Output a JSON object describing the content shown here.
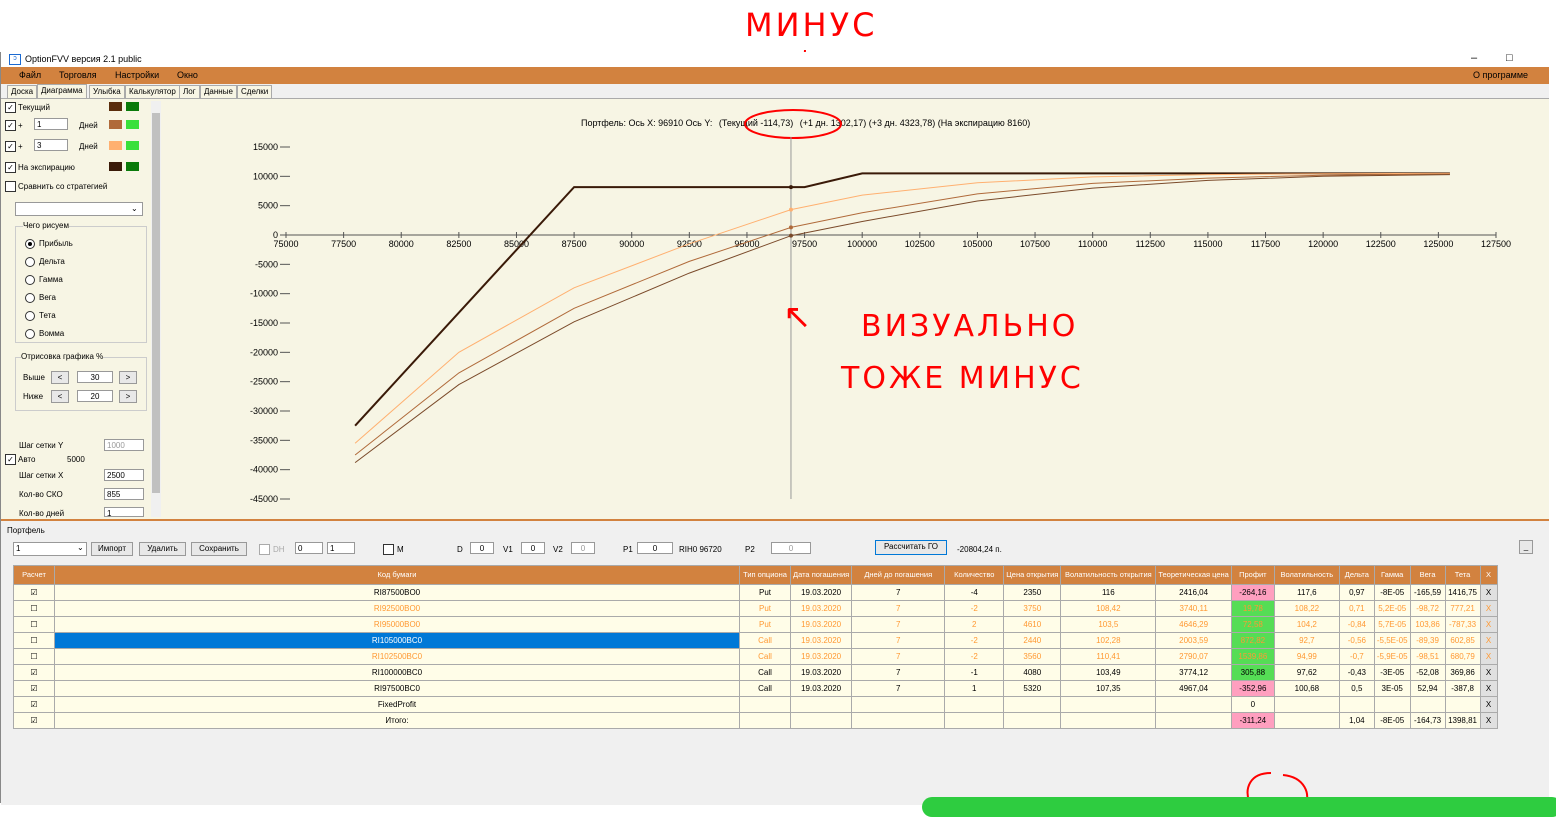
{
  "annotations": {
    "top": "МИНУС",
    "middle_line1": "ВИЗУАЛЬНО",
    "middle_line2": "ТОЖЕ МИНУС",
    "arrow_glyph": "↖"
  },
  "window": {
    "title": "OptionFVV версия 2.1 public",
    "min": "–",
    "max": "□"
  },
  "menu": {
    "items": [
      "Файл",
      "Торговля",
      "Настройки",
      "Окно"
    ],
    "about": "О программе"
  },
  "tabs": [
    "Доска",
    "Диаграмма",
    "Улыбка",
    "Калькулятор",
    "Лог",
    "Данные",
    "Сделки"
  ],
  "left": {
    "current": "Текущий",
    "plus": "+",
    "days1": "1",
    "days_label": "Дней",
    "days2": "3",
    "expiration": "На экспирацию",
    "compare": "Сравнить со стратегией",
    "what_draw": "Чего рисуем",
    "radios": [
      "Прибыль",
      "Дельта",
      "Гамма",
      "Вега",
      "Тета",
      "Вомма"
    ],
    "draw_pct": "Отрисовка графика %",
    "above": "Выше",
    "above_val": "30",
    "below": "Ниже",
    "below_val": "20",
    "lt": "<",
    "gt": ">",
    "grid_y": "Шаг сетки Y",
    "grid_y_val": "1000",
    "auto": "Авто",
    "auto_val": "5000",
    "grid_x": "Шаг сетки X",
    "grid_x_val": "2500",
    "sko": "Кол-во СКО",
    "sko_val": "855",
    "days_count": "Кол-во дней",
    "days_count_val": "1"
  },
  "colors": {
    "current_dark": "#5a2d0c",
    "current_green": "#0a7a0a",
    "plus1_brown": "#b06a3a",
    "plus1_green": "#3ae03a",
    "plus3_orange": "#ffb070",
    "plus3_green": "#3ae03a",
    "exp_dark": "#3a1a08",
    "exp_green": "#0a7a0a",
    "menu": "#d2823f"
  },
  "chart_header": {
    "prefix": "Портфель: Ось X: 96910 Ось Y:",
    "current": "(Текущий -114,73)",
    "rest": "(+1 дн. 1302,17)  (+3 дн. 4323,78)  (На экспирацию 8160)"
  },
  "chart_data": {
    "type": "line",
    "x_ticks": [
      "75000",
      "77500",
      "80000",
      "82500",
      "85000",
      "87500",
      "90000",
      "92500",
      "95000",
      "97500",
      "100000",
      "102500",
      "105000",
      "107500",
      "110000",
      "112500",
      "115000",
      "117500",
      "120000",
      "122500",
      "125000",
      "127500"
    ],
    "y_ticks": [
      "15000",
      "10000",
      "5000",
      "0",
      "-5000",
      "-10000",
      "-15000",
      "-20000",
      "-25000",
      "-30000",
      "-35000",
      "-40000",
      "-45000"
    ],
    "xlim": [
      75000,
      127500
    ],
    "ylim": [
      -45000,
      15000
    ],
    "cursor_x": 96910,
    "series": [
      {
        "color": "#3a1a08",
        "x": [
          78000,
          87500,
          96910,
          97500,
          100000,
          125500
        ],
        "y": [
          -32500,
          8160,
          8160,
          8160,
          10500,
          10500
        ]
      },
      {
        "color": "#ffb070",
        "x": [
          78000,
          82500,
          87500,
          92500,
          96910,
          100000,
          105000,
          110000,
          115000,
          120000,
          125500
        ],
        "y": [
          -35500,
          -20000,
          -9000,
          -1500,
          4324,
          6800,
          8900,
          9900,
          10300,
          10450,
          10500
        ]
      },
      {
        "color": "#b06a3a",
        "x": [
          78000,
          82500,
          87500,
          92500,
          96910,
          100000,
          105000,
          110000,
          115000,
          120000,
          125500
        ],
        "y": [
          -37500,
          -23500,
          -12500,
          -4500,
          1302,
          3800,
          7000,
          8800,
          9700,
          10200,
          10400
        ]
      },
      {
        "color": "#7a4a2a",
        "x": [
          78000,
          82500,
          87500,
          92500,
          96910,
          100000,
          105000,
          110000,
          115000,
          120000,
          125500
        ],
        "y": [
          -38800,
          -25500,
          -14800,
          -6500,
          -115,
          2300,
          5800,
          8000,
          9300,
          10000,
          10300
        ]
      }
    ]
  },
  "portfolio": {
    "title": "Портфель",
    "select": "1",
    "import": "Импорт",
    "delete": "Удалить",
    "save": "Сохранить",
    "dh": "DH",
    "dh_v1": "0",
    "dh_v2": "1",
    "m": "M",
    "d": "D",
    "d_val": "0",
    "v1": "V1",
    "v1_val": "0",
    "v2": "V2",
    "v2_val": "0",
    "p1": "P1",
    "p1_val": "0",
    "rih": "RIH0 96720",
    "p2": "P2",
    "p2_val": "0",
    "calc_go": "Рассчитать ГО",
    "go_val": "-20804,24 п.",
    "collapse": "_"
  },
  "table": {
    "headers": [
      "Расчет",
      "Код бумаги",
      "Тип опциона",
      "Дата погашения",
      "Дней до погашения",
      "Количество",
      "Цена открытия",
      "Волатильность открытия",
      "Теоретическая цена",
      "Профит",
      "Волатильность",
      "Дельта",
      "Гамма",
      "Вега",
      "Тета",
      "X"
    ],
    "rows": [
      {
        "check": "☑",
        "code": "RI87500BO0",
        "type": "Put",
        "date": "19.03.2020",
        "days": "7",
        "qty": "-4",
        "price": "2350",
        "vol_open": "116",
        "theo": "2416,04",
        "profit": "-264,16",
        "vol": "117,6",
        "delta": "0,97",
        "gamma": "-8E-05",
        "vega": "-165,59",
        "theta": "1416,75",
        "x": "X"
      },
      {
        "check": "☐",
        "code": "RI92500BO0",
        "type": "Put",
        "date": "19.03.2020",
        "days": "7",
        "qty": "-2",
        "price": "3750",
        "vol_open": "108,42",
        "theo": "3740,11",
        "profit": "19,78",
        "vol": "108,22",
        "delta": "0,71",
        "gamma": "5,2E-05",
        "vega": "-98,72",
        "theta": "777,21",
        "x": "X"
      },
      {
        "check": "☐",
        "code": "RI95000BO0",
        "type": "Put",
        "date": "19.03.2020",
        "days": "7",
        "qty": "2",
        "price": "4610",
        "vol_open": "103,5",
        "theo": "4646,29",
        "profit": "72,58",
        "vol": "104,2",
        "delta": "-0,84",
        "gamma": "5,7E-05",
        "vega": "103,86",
        "theta": "-787,33",
        "x": "X"
      },
      {
        "check": "☐",
        "code": "RI105000BC0",
        "type": "Call",
        "date": "19.03.2020",
        "days": "7",
        "qty": "-2",
        "price": "2440",
        "vol_open": "102,28",
        "theo": "2003,59",
        "profit": "872,82",
        "vol": "92,7",
        "delta": "-0,56",
        "gamma": "-5,5E-05",
        "vega": "-89,39",
        "theta": "602,85",
        "x": "X"
      },
      {
        "check": "☐",
        "code": "RI102500BC0",
        "type": "Call",
        "date": "19.03.2020",
        "days": "7",
        "qty": "-2",
        "price": "3560",
        "vol_open": "110,41",
        "theo": "2790,07",
        "profit": "1539,86",
        "vol": "94,99",
        "delta": "-0,7",
        "gamma": "-5,9E-05",
        "vega": "-98,51",
        "theta": "680,79",
        "x": "X"
      },
      {
        "check": "☑",
        "code": "RI100000BC0",
        "type": "Call",
        "date": "19.03.2020",
        "days": "7",
        "qty": "-1",
        "price": "4080",
        "vol_open": "103,49",
        "theo": "3774,12",
        "profit": "305,88",
        "vol": "97,62",
        "delta": "-0,43",
        "gamma": "-3E-05",
        "vega": "-52,08",
        "theta": "369,86",
        "x": "X"
      },
      {
        "check": "☑",
        "code": "RI97500BC0",
        "type": "Call",
        "date": "19.03.2020",
        "days": "7",
        "qty": "1",
        "price": "5320",
        "vol_open": "107,35",
        "theo": "4967,04",
        "profit": "-352,96",
        "vol": "100,68",
        "delta": "0,5",
        "gamma": "3E-05",
        "vega": "52,94",
        "theta": "-387,8",
        "x": "X"
      },
      {
        "check": "☑",
        "code": "FixedProfit",
        "type": "",
        "date": "",
        "days": "",
        "qty": "",
        "price": "",
        "vol_open": "",
        "theo": "",
        "profit": "0",
        "vol": "",
        "delta": "",
        "gamma": "",
        "vega": "",
        "theta": "",
        "x": "X"
      },
      {
        "check": "☑",
        "code": "Итого:",
        "type": "",
        "date": "",
        "days": "",
        "qty": "",
        "price": "",
        "vol_open": "",
        "theo": "",
        "profit": "-311,24",
        "vol": "",
        "delta": "1,04",
        "gamma": "-8E-05",
        "vega": "-164,73",
        "theta": "1398,81",
        "x": "X"
      }
    ]
  }
}
